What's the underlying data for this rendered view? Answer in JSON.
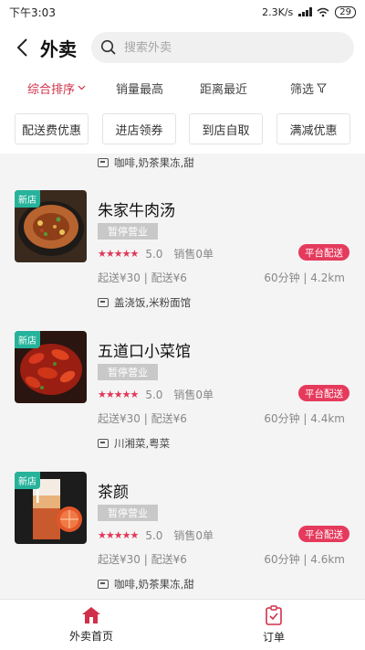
{
  "status": {
    "time": "下午3:03",
    "speed": "2.3K/s",
    "battery": "29"
  },
  "header": {
    "title": "外卖",
    "search_placeholder": "搜索外卖"
  },
  "sort": {
    "items": [
      "综合排序",
      "销量最高",
      "距离最近",
      "筛选"
    ]
  },
  "filters": [
    "配送费优惠",
    "进店领券",
    "到店自取",
    "满减优惠"
  ],
  "top_tags": "咖啡,奶茶果冻,甜",
  "stores": [
    {
      "badge": "新店",
      "name": "朱家牛肉汤",
      "status": "暂停营业",
      "rating": "5.0",
      "sales": "销售0单",
      "platform": "平台配送",
      "delivery": "起送¥30 | 配送¥6",
      "distance": "60分钟 | 4.2km",
      "tags": "盖浇饭,米粉面馆"
    },
    {
      "badge": "新店",
      "name": "五道口小菜馆",
      "status": "暂停营业",
      "rating": "5.0",
      "sales": "销售0单",
      "platform": "平台配送",
      "delivery": "起送¥30 | 配送¥6",
      "distance": "60分钟 | 4.4km",
      "tags": "川湘菜,粤菜"
    },
    {
      "badge": "新店",
      "name": "茶颜",
      "status": "暂停营业",
      "rating": "5.0",
      "sales": "销售0单",
      "platform": "平台配送",
      "delivery": "起送¥30 | 配送¥6",
      "distance": "60分钟 | 4.6km",
      "tags": "咖啡,奶茶果冻,甜"
    }
  ],
  "bottomnav": {
    "home": "外卖首页",
    "orders": "订单"
  },
  "colors": {
    "accent": "#d0304a",
    "platform": "#e53a5c",
    "new_badge": "#27b39b"
  }
}
